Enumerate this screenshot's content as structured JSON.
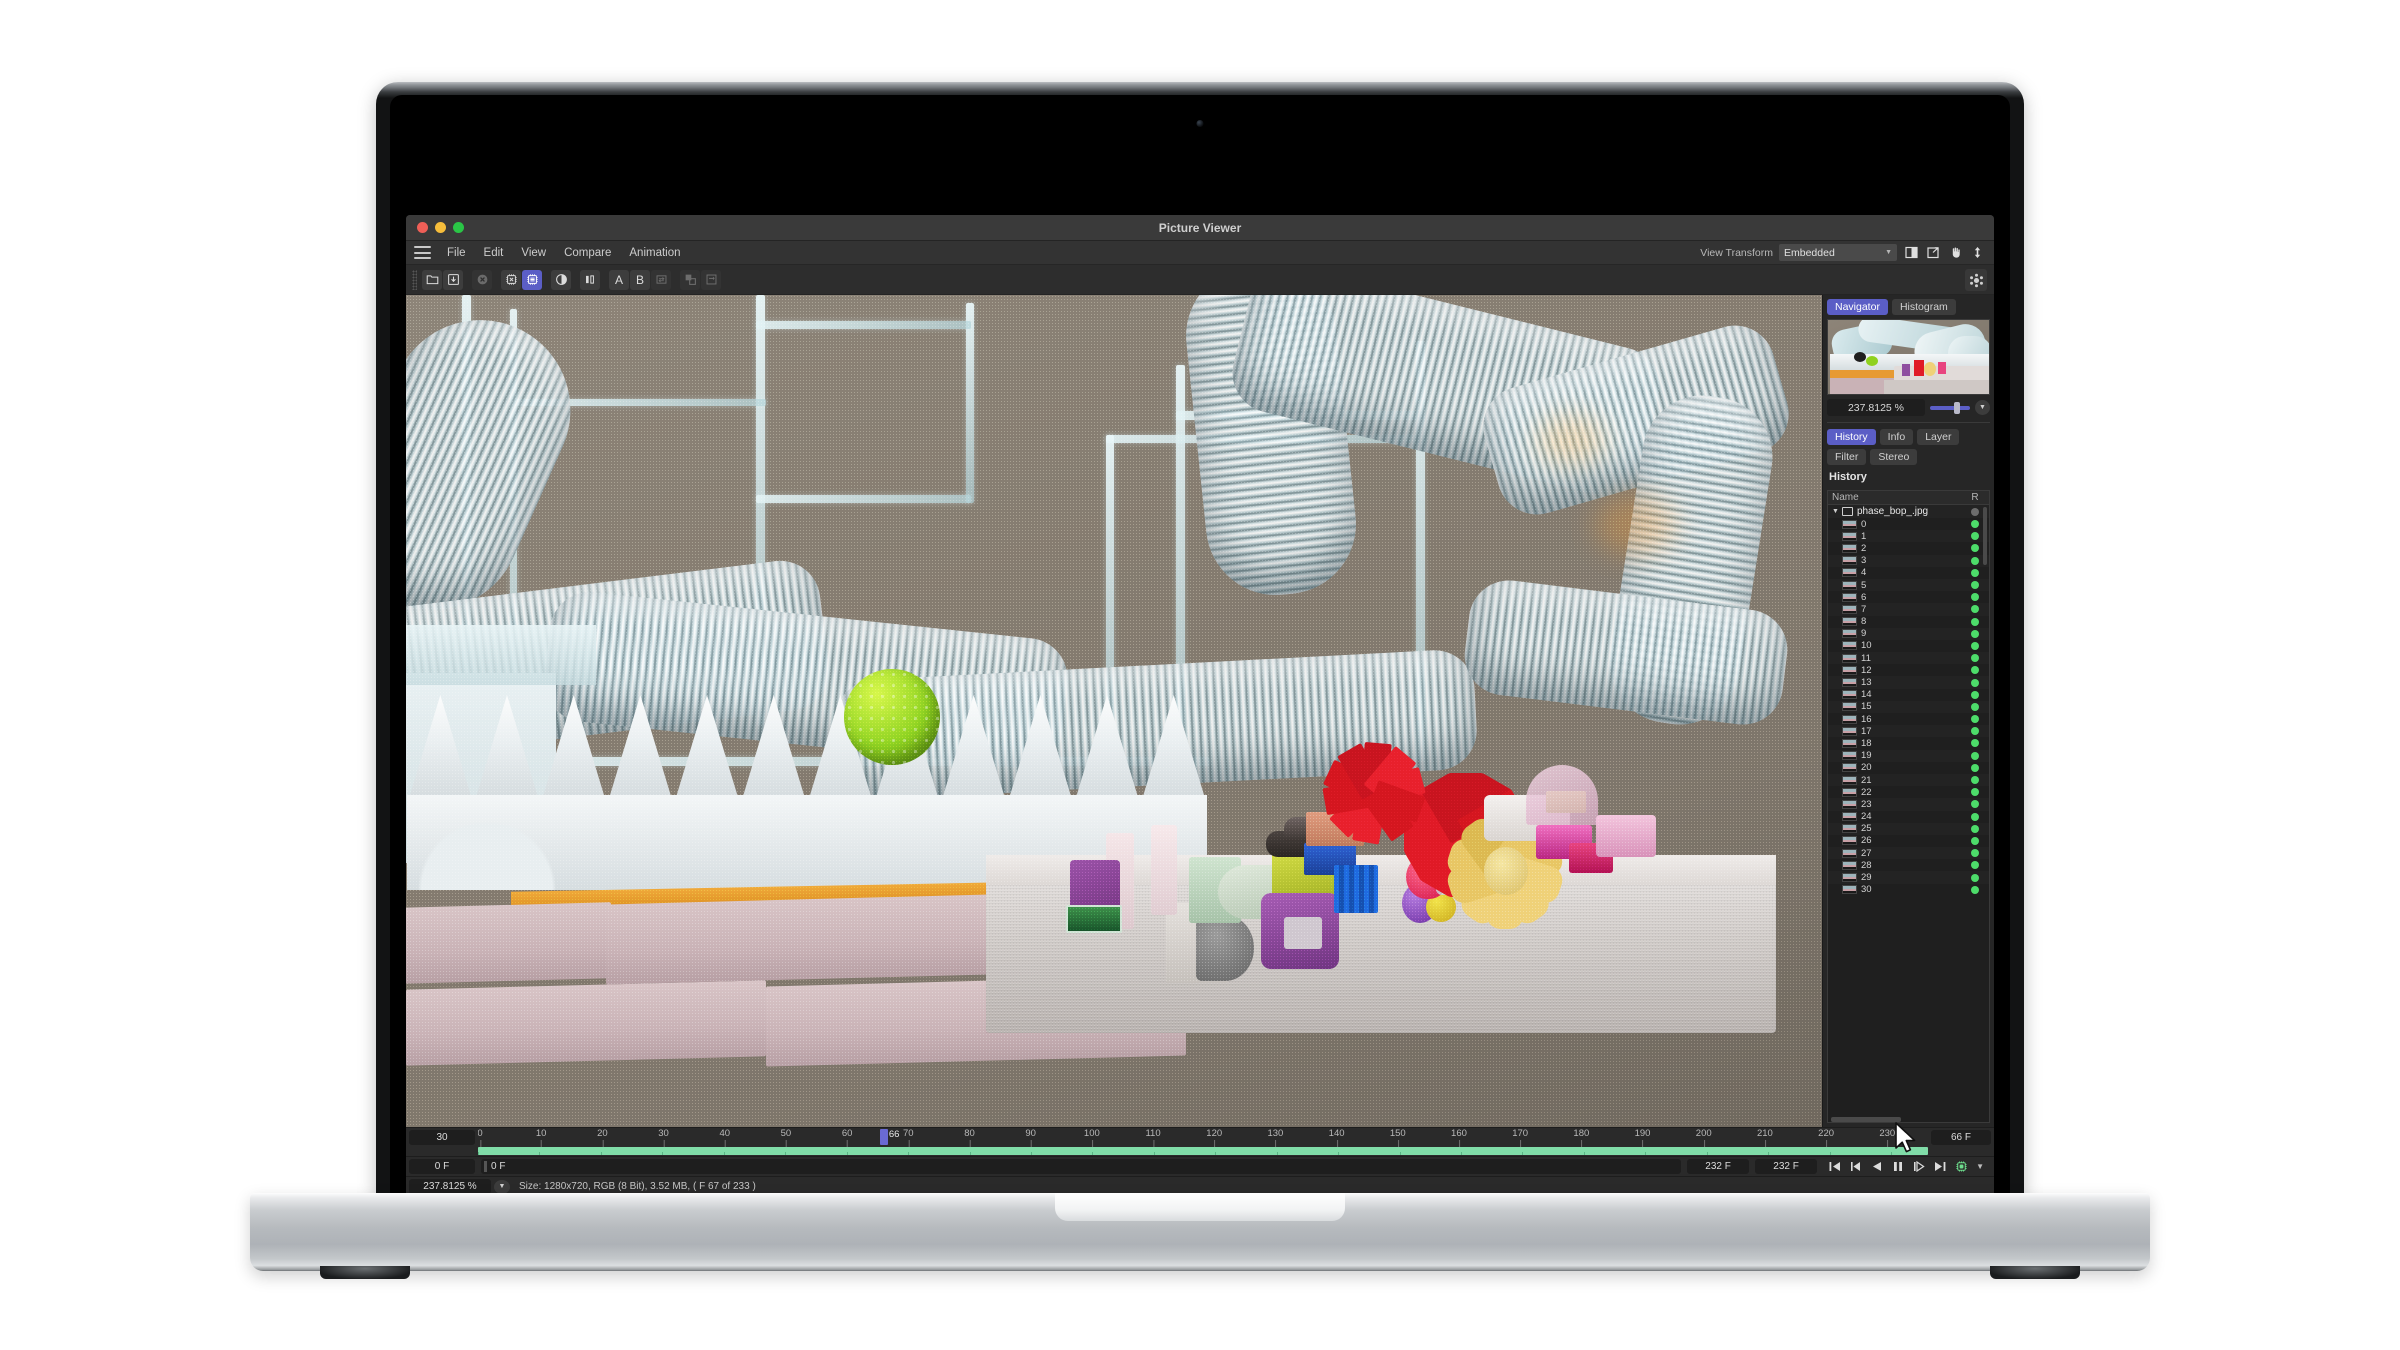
{
  "window": {
    "title": "Picture Viewer"
  },
  "menubar": {
    "hamburger_icon": "hamburger-menu-icon",
    "items": [
      "File",
      "Edit",
      "View",
      "Compare",
      "Animation"
    ],
    "view_transform_label": "View Transform",
    "view_transform_value": "Embedded",
    "right_icons": [
      "split-view-icon",
      "external-window-icon",
      "pan-hand-icon",
      "vertical-resize-icon"
    ]
  },
  "toolbar": {
    "buttons": [
      {
        "name": "open-folder-button",
        "icon": "folder-icon",
        "state": "normal"
      },
      {
        "name": "save-download-button",
        "icon": "download-arrow-icon",
        "state": "normal"
      },
      {
        "name": "close-image-button",
        "icon": "close-circle-icon",
        "state": "disabled"
      },
      {
        "name": "gpu-off-button",
        "icon": "chip-x-icon",
        "state": "normal"
      },
      {
        "name": "gpu-on-button",
        "icon": "chip-lines-icon",
        "state": "active"
      },
      {
        "name": "contrast-button",
        "icon": "half-circle-icon",
        "state": "normal"
      },
      {
        "name": "flip-button",
        "icon": "flip-horizontal-icon",
        "state": "normal"
      },
      {
        "name": "buffer-a-button",
        "icon": "letter-a-icon",
        "state": "normal",
        "label": "A"
      },
      {
        "name": "buffer-b-button",
        "icon": "letter-b-icon",
        "state": "normal",
        "label": "B"
      },
      {
        "name": "swap-buffer-button",
        "icon": "swap-icon",
        "state": "disabled"
      },
      {
        "name": "duplicate-button",
        "icon": "duplicate-icon",
        "state": "disabled"
      },
      {
        "name": "export-button",
        "icon": "export-arrow-icon",
        "state": "disabled"
      }
    ],
    "right_icon": "molecule-settings-icon"
  },
  "right_panel": {
    "top_tabs": [
      {
        "label": "Navigator",
        "selected": true
      },
      {
        "label": "Histogram",
        "selected": false
      }
    ],
    "zoom_value": "237.8125 %",
    "mid_tabs": [
      {
        "label": "History",
        "selected": true
      },
      {
        "label": "Info",
        "selected": false
      },
      {
        "label": "Layer",
        "selected": false
      },
      {
        "label": "Filter",
        "selected": false
      },
      {
        "label": "Stereo",
        "selected": false
      }
    ],
    "history": {
      "title": "History",
      "columns": [
        "Name",
        "R"
      ],
      "root": {
        "label": "phase_bop_.jpg",
        "status": "grey"
      },
      "items": [
        {
          "label": "0",
          "status": "green"
        },
        {
          "label": "1",
          "status": "green"
        },
        {
          "label": "2",
          "status": "green"
        },
        {
          "label": "3",
          "status": "green"
        },
        {
          "label": "4",
          "status": "green"
        },
        {
          "label": "5",
          "status": "green"
        },
        {
          "label": "6",
          "status": "green"
        },
        {
          "label": "7",
          "status": "green"
        },
        {
          "label": "8",
          "status": "green"
        },
        {
          "label": "9",
          "status": "green"
        },
        {
          "label": "10",
          "status": "green"
        },
        {
          "label": "11",
          "status": "green"
        },
        {
          "label": "12",
          "status": "green"
        },
        {
          "label": "13",
          "status": "green"
        },
        {
          "label": "14",
          "status": "green"
        },
        {
          "label": "15",
          "status": "green"
        },
        {
          "label": "16",
          "status": "green"
        },
        {
          "label": "17",
          "status": "green"
        },
        {
          "label": "18",
          "status": "green"
        },
        {
          "label": "19",
          "status": "green"
        },
        {
          "label": "20",
          "status": "green"
        },
        {
          "label": "21",
          "status": "green"
        },
        {
          "label": "22",
          "status": "green"
        },
        {
          "label": "23",
          "status": "green"
        },
        {
          "label": "24",
          "status": "green"
        },
        {
          "label": "25",
          "status": "green"
        },
        {
          "label": "26",
          "status": "green"
        },
        {
          "label": "27",
          "status": "green"
        },
        {
          "label": "28",
          "status": "green"
        },
        {
          "label": "29",
          "status": "green"
        },
        {
          "label": "30",
          "status": "green"
        }
      ]
    }
  },
  "timeline": {
    "fps_field": "30",
    "ticks": [
      "0",
      "10",
      "20",
      "30",
      "40",
      "50",
      "60",
      "70",
      "80",
      "90",
      "100",
      "110",
      "120",
      "130",
      "140",
      "150",
      "160",
      "170",
      "180",
      "190",
      "200",
      "210",
      "220",
      "230"
    ],
    "playhead_label": "66",
    "playhead_frame": 66,
    "range_end_label": "66 F",
    "start_field": "0 F",
    "current_frame_field": "0 F",
    "out_point_field": "232 F",
    "total_frames_field": "232 F",
    "transport": [
      {
        "name": "go-to-start-button",
        "icon": "skip-to-start-icon"
      },
      {
        "name": "step-back-button",
        "icon": "step-backward-icon"
      },
      {
        "name": "play-reverse-button",
        "icon": "play-reverse-icon"
      },
      {
        "name": "pause-button",
        "icon": "pause-icon"
      },
      {
        "name": "play-forward-button",
        "icon": "play-forward-icon"
      },
      {
        "name": "go-to-end-button",
        "icon": "skip-to-end-icon"
      },
      {
        "name": "render-cache-button",
        "icon": "chip-square-icon"
      }
    ]
  },
  "status_bar": {
    "zoom": "237.8125 %",
    "info": "Size: 1280x720, RGB (8 Bit), 3.52 MB,  ( F 67 of 233 )"
  },
  "colors": {
    "accent_purple": "#5b5ec6",
    "track_green": "#80dca8",
    "status_green": "#4ddc6a",
    "window_bg": "#2a2a2a",
    "panel_bg": "#262626"
  }
}
